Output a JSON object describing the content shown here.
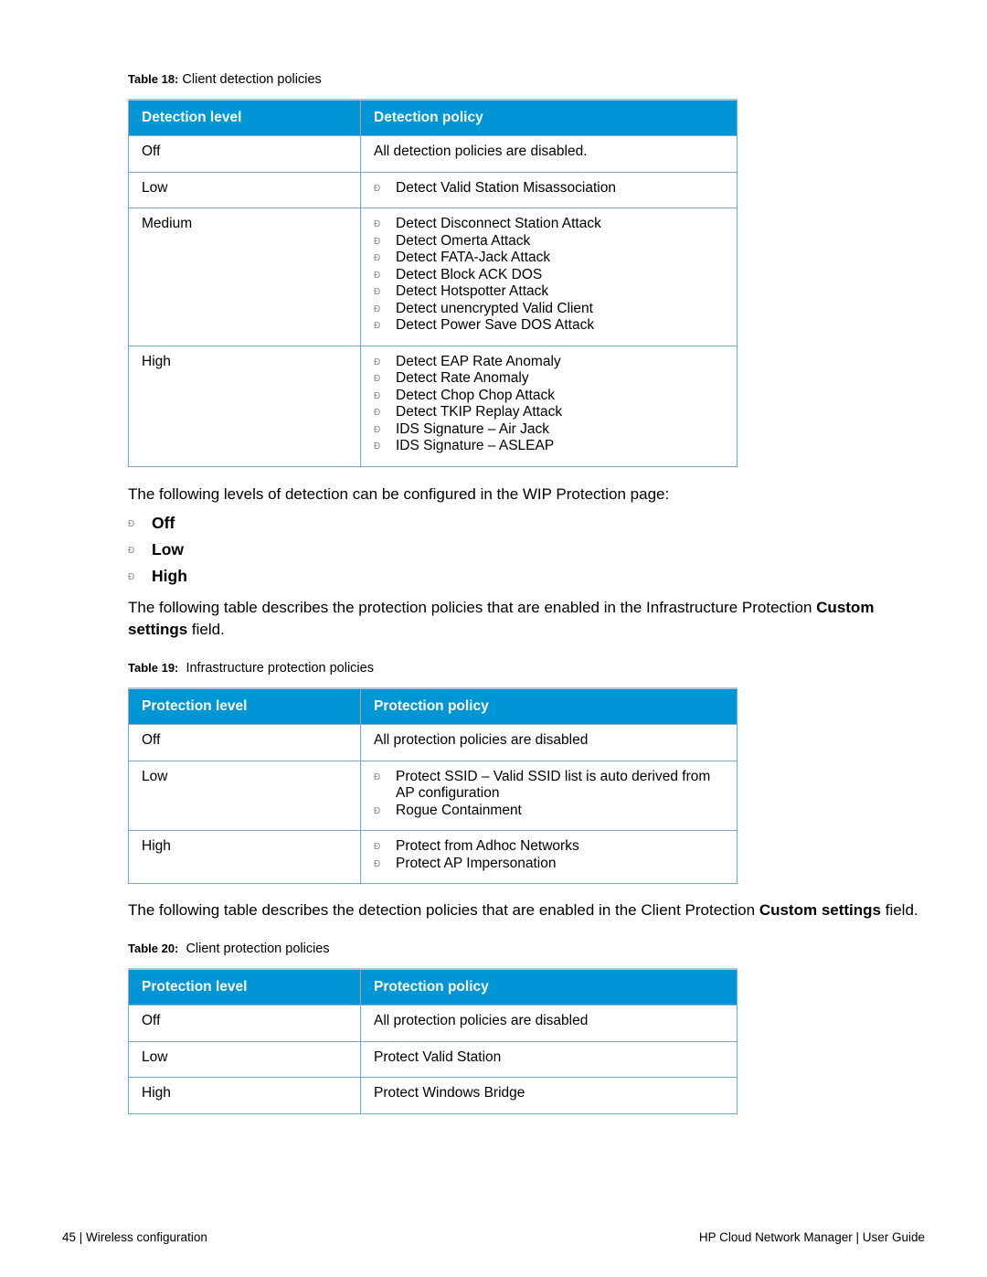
{
  "table18": {
    "caption_label": "Table 18:",
    "caption_text": " Client detection policies",
    "headers": [
      "Detection level",
      "Detection policy"
    ],
    "rows": [
      {
        "level": "Off",
        "policy": "All detection policies are disabled."
      },
      {
        "level": "Low",
        "items": [
          "Detect Valid Station Misassociation"
        ]
      },
      {
        "level": "Medium",
        "items": [
          "Detect Disconnect Station Attack",
          "Detect Omerta Attack",
          "Detect FATA-Jack Attack",
          "Detect Block ACK DOS",
          "Detect Hotspotter Attack",
          "Detect unencrypted Valid Client",
          "Detect Power Save DOS Attack"
        ]
      },
      {
        "level": "High",
        "items": [
          "Detect EAP Rate Anomaly",
          "Detect Rate Anomaly",
          "Detect Chop Chop Attack",
          "Detect TKIP Replay Attack",
          "IDS Signature – Air Jack",
          "IDS Signature – ASLEAP"
        ]
      }
    ]
  },
  "intro_levels": "The following levels of detection can be configured in the WIP Protection page:",
  "levels": [
    "Off",
    "Low",
    "High"
  ],
  "intro_infra": {
    "pre": "The following table describes the protection policies that are enabled in the Infrastructure Protection ",
    "bold1": "Custom",
    "bold2": "settings",
    "post": " field."
  },
  "table19": {
    "caption_label": "Table 19:",
    "caption_text": "  Infrastructure protection policies",
    "headers": [
      "Protection level",
      "Protection policy"
    ],
    "rows": [
      {
        "level": "Off",
        "policy": "All protection policies are disabled"
      },
      {
        "level": "Low",
        "items": [
          "Protect SSID – Valid SSID list is auto derived from AP configuration",
          "Rogue Containment"
        ]
      },
      {
        "level": "High",
        "items": [
          "Protect from Adhoc Networks",
          "Protect AP Impersonation"
        ]
      }
    ]
  },
  "intro_client": {
    "pre": "The following table describes the detection policies that are enabled in the Client Protection ",
    "bold": "Custom settings",
    "post": " field."
  },
  "table20": {
    "caption_label": "Table 20:",
    "caption_text": "  Client protection policies",
    "headers": [
      "Protection level",
      "Protection policy"
    ],
    "rows": [
      {
        "level": "Off",
        "policy": "All protection policies are disabled"
      },
      {
        "level": "Low",
        "policy": "Protect Valid Station"
      },
      {
        "level": "High",
        "policy": "Protect Windows Bridge"
      }
    ]
  },
  "footer": {
    "left": "45 | Wireless configuration",
    "right": "HP Cloud Network Manager | User Guide"
  },
  "colors": {
    "header_bg": "#0096d6",
    "border": "#7aa7c7",
    "bullet": "#888888"
  }
}
